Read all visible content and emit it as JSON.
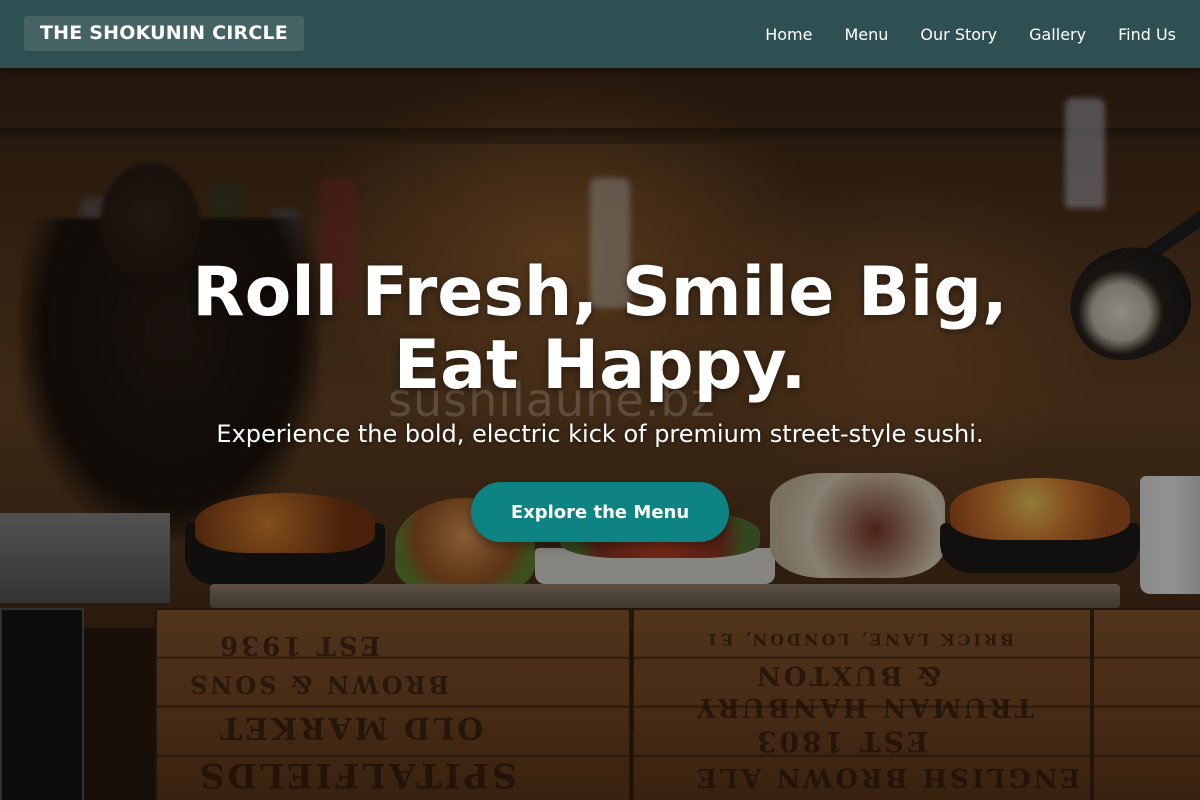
{
  "header": {
    "logo": "THE SHOKUNIN CIRCLE",
    "nav": [
      {
        "label": "Home"
      },
      {
        "label": "Menu"
      },
      {
        "label": "Our Story"
      },
      {
        "label": "Gallery"
      },
      {
        "label": "Find Us"
      }
    ]
  },
  "hero": {
    "headline_line1": "Roll Fresh, Smile Big,",
    "headline_line2": "Eat Happy.",
    "subheadline": "Experience the bold, electric kick of premium street-style sushi.",
    "cta_label": "Explore the Menu",
    "watermark": "sushilaune.bz"
  },
  "colors": {
    "header_bg": "#2f5052",
    "logo_bg": "#456365",
    "cta_bg": "#0e8384",
    "text": "#ffffff"
  }
}
